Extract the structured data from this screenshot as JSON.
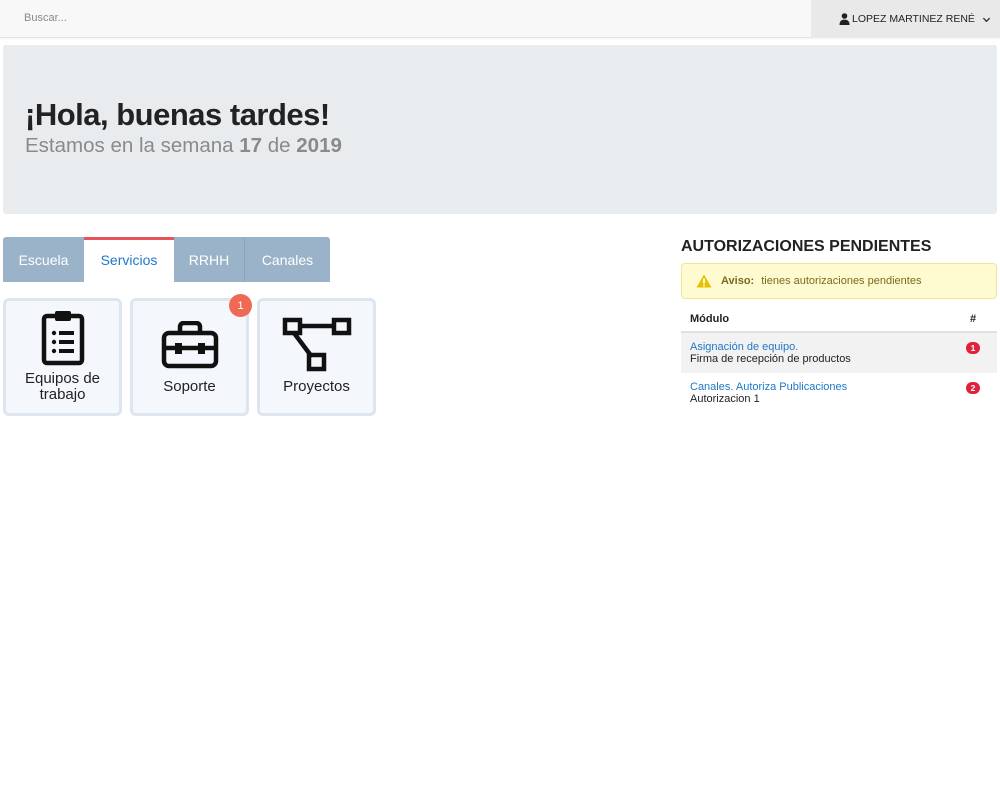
{
  "search": {
    "placeholder": "Buscar..."
  },
  "user": {
    "name": "LOPEZ MARTINEZ RENÉ"
  },
  "jumbotron": {
    "greeting": "¡Hola, buenas tardes!",
    "week_prefix": "Estamos en la semana",
    "week_number": "17",
    "week_connector": "de",
    "year": "2019"
  },
  "tabs": [
    {
      "label": "Escuela",
      "active": false
    },
    {
      "label": "Servicios",
      "active": true
    },
    {
      "label": "RRHH",
      "active": false
    },
    {
      "label": "Canales",
      "active": false
    }
  ],
  "tiles": [
    {
      "label_line1": "Equipos de",
      "label_line2": "trabajo",
      "icon": "clipboard-list-icon"
    },
    {
      "label": "Soporte",
      "icon": "toolbox-icon",
      "badge": "1"
    },
    {
      "label": "Proyectos",
      "icon": "project-diagram-icon"
    }
  ],
  "authorizations": {
    "title": "AUTORIZACIONES PENDIENTES",
    "alert_label": "Aviso:",
    "alert_text": "tienes autorizaciones pendientes",
    "col_module": "Módulo",
    "col_count": "#",
    "rows": [
      {
        "link": "Asignación de equipo.",
        "sub": "Firma de recepción de productos",
        "count": "1"
      },
      {
        "link": "Canales. Autoriza Publicaciones",
        "sub": "Autorizacion 1",
        "count": "2"
      }
    ]
  },
  "colors": {
    "tab_bar": "#9ab3c9",
    "active_tab_text": "#1f78c7",
    "active_tab_accent": "#e8535a",
    "alert_bg": "#fefbd1",
    "badge_red": "#e0213b",
    "badge_orange": "#ee6a55"
  }
}
